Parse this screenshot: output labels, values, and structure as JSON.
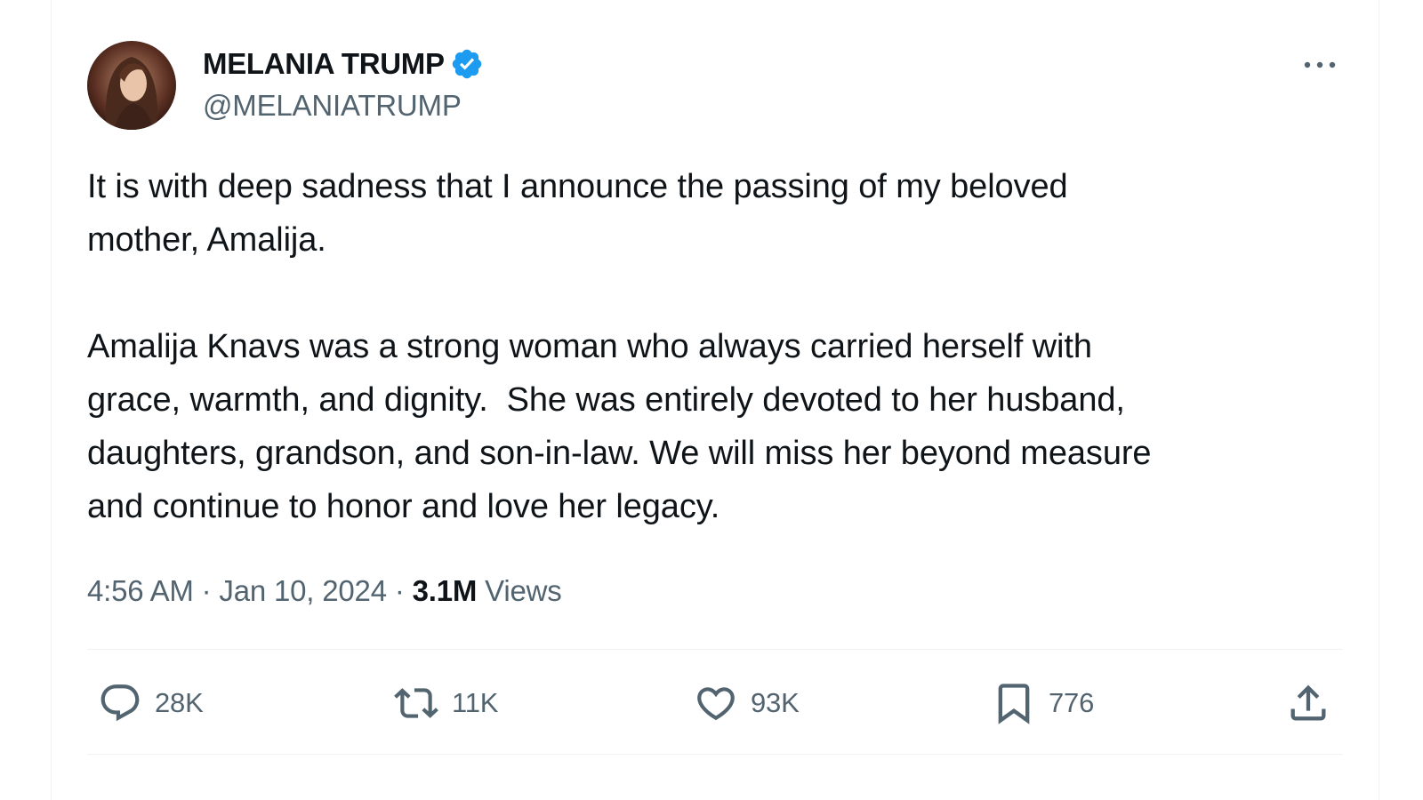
{
  "author": {
    "name": "MELANIA TRUMP",
    "handle": "@MELANIATRUMP",
    "verified": true
  },
  "tweet": {
    "paragraphs": [
      "It is with deep sadness that I announce the passing of my beloved\nmother, Amalija.",
      "Amalija Knavs was a strong woman who always carried herself with\ngrace, warmth, and dignity.  She was entirely devoted to her husband,\ndaughters, grandson, and son-in-law. We will miss her beyond measure\nand continue to honor and love her legacy."
    ]
  },
  "meta": {
    "time": "4:56 AM",
    "separator": " · ",
    "date": "Jan 10, 2024",
    "views_count": "3.1M",
    "views_label": " Views"
  },
  "actions": {
    "replies": "28K",
    "reposts": "11K",
    "likes": "93K",
    "bookmarks": "776"
  },
  "icons": {
    "verified": "verified-badge-icon",
    "more": "more-dots-icon",
    "reply": "reply-icon",
    "repost": "repost-icon",
    "like": "heart-icon",
    "bookmark": "bookmark-icon",
    "share": "share-icon"
  },
  "colors": {
    "verified_blue": "#1d9bf0",
    "secondary_text": "#536471",
    "primary_text": "#0f1419",
    "divider": "#eff3f4"
  }
}
